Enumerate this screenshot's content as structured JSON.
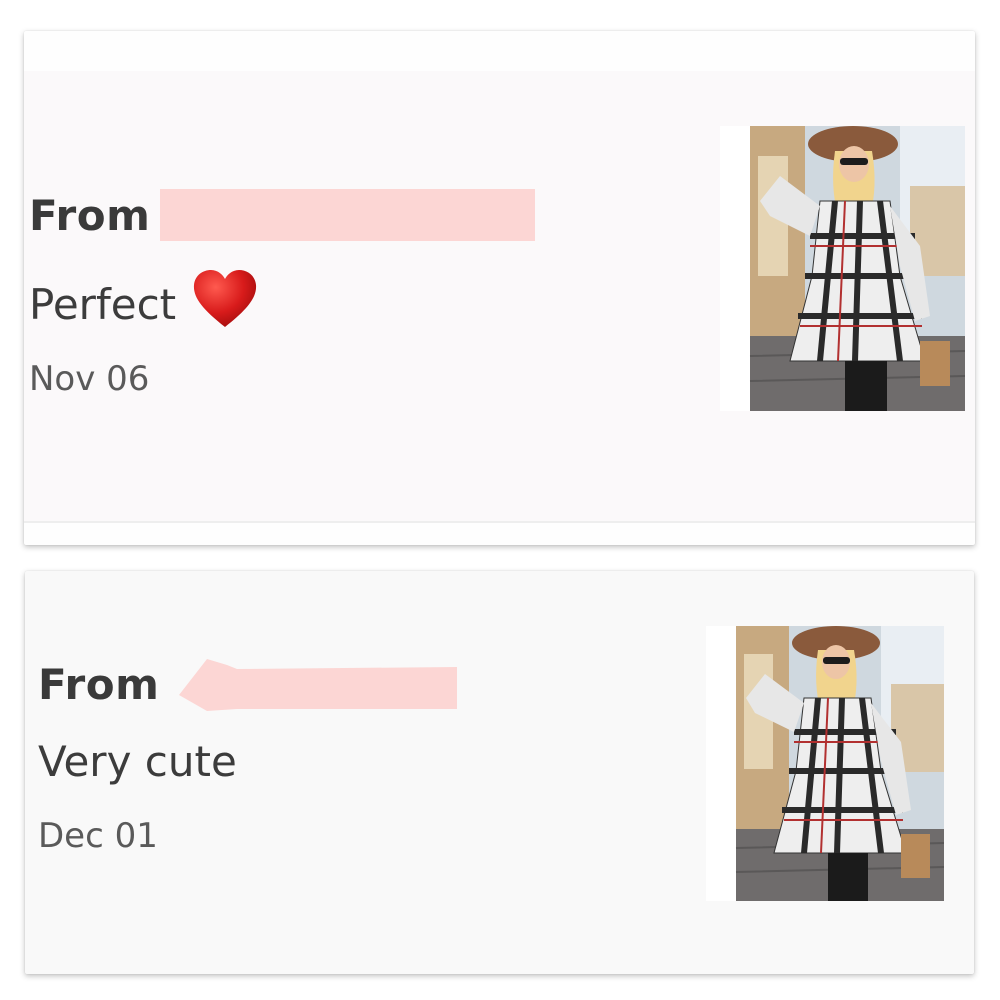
{
  "reviews": [
    {
      "from_label": "From",
      "message": "Perfect",
      "emoji": "heart-icon",
      "date": "Nov 06",
      "thumbnail": "product-thumbnail"
    },
    {
      "from_label": "From",
      "message": "Very cute",
      "date": "Dec 01",
      "thumbnail": "product-thumbnail"
    }
  ],
  "colors": {
    "redaction": "#fcd6d4",
    "heart": "#d81b1b",
    "text_primary": "#3a3a3a",
    "text_secondary": "#5a5a5a"
  }
}
